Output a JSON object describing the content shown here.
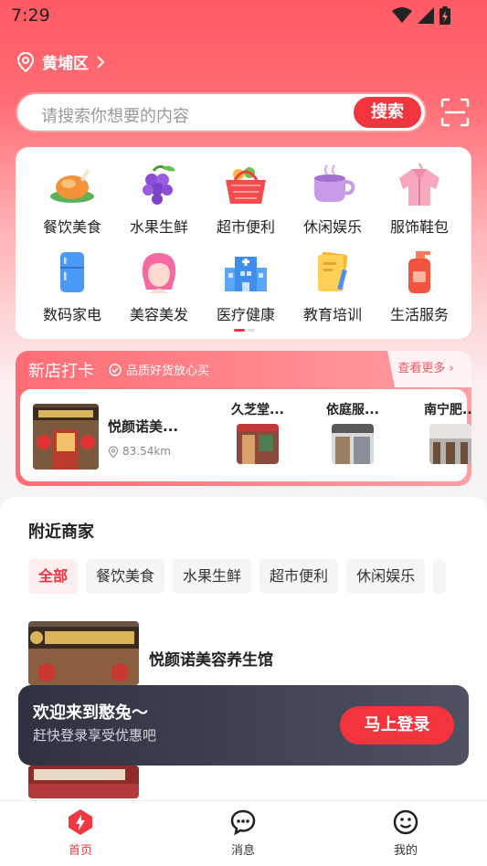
{
  "status_bar": {
    "time": "7:29"
  },
  "location": {
    "district": "黄埔区"
  },
  "search": {
    "placeholder": "请搜索你想要的内容",
    "button": "搜索"
  },
  "categories": [
    {
      "label": "餐饮美食",
      "icon": "roast-chicken-icon"
    },
    {
      "label": "水果生鲜",
      "icon": "grapes-icon"
    },
    {
      "label": "超市便利",
      "icon": "shopping-basket-icon"
    },
    {
      "label": "休闲娱乐",
      "icon": "coffee-cup-icon"
    },
    {
      "label": "服饰鞋包",
      "icon": "jacket-icon"
    },
    {
      "label": "数码家电",
      "icon": "refrigerator-icon"
    },
    {
      "label": "美容美发",
      "icon": "woman-face-icon"
    },
    {
      "label": "医疗健康",
      "icon": "hospital-icon"
    },
    {
      "label": "教育培训",
      "icon": "notebook-icon"
    },
    {
      "label": "生活服务",
      "icon": "lotion-bottle-icon"
    }
  ],
  "new_shops": {
    "title": "新店打卡",
    "tagline": "品质好货放心买",
    "more": "查看更多",
    "featured": {
      "name": "悦颜诺美...",
      "distance": "83.54km"
    },
    "others": [
      {
        "name": "久芝堂..."
      },
      {
        "name": "依庭服..."
      },
      {
        "name": "南宁肥..."
      }
    ]
  },
  "nearby": {
    "title": "附近商家",
    "filters": [
      "全部",
      "餐饮美食",
      "水果生鲜",
      "超市便利",
      "休闲娱乐"
    ],
    "shops": [
      {
        "name": "悦颜诺美容养生馆"
      }
    ]
  },
  "login_banner": {
    "title": "欢迎来到憨兔～",
    "subtitle": "赶快登录享受优惠吧",
    "button": "马上登录"
  },
  "tab_bar": [
    {
      "label": "首页",
      "active": true
    },
    {
      "label": "消息",
      "active": false
    },
    {
      "label": "我的",
      "active": false
    }
  ],
  "colors": {
    "accent": "#f0353f",
    "header": "#ff5a63",
    "banner": "#3a3d4b"
  }
}
